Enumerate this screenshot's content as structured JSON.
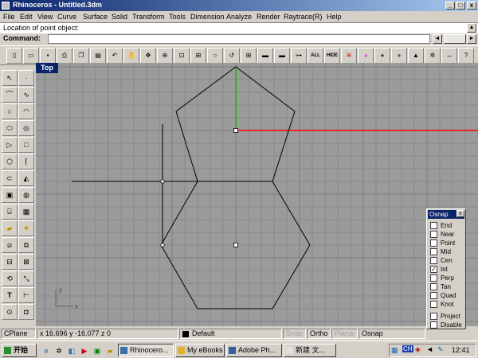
{
  "window": {
    "title": "Rhinoceros - Untitled.3dm",
    "buttons": [
      "_",
      "□",
      "x"
    ]
  },
  "menu": [
    "File",
    "Edit",
    "View",
    "Curve",
    "Surface",
    "Solid",
    "Transform",
    "Tools",
    "Dimension",
    "Analyze",
    "Render",
    "Raytrace(R)",
    "Help"
  ],
  "command": {
    "prompt": "Location of point object:",
    "label": "Command:",
    "value": ""
  },
  "toolbar": {
    "all_label": "ALL",
    "hide_label": "HIDE"
  },
  "viewport": {
    "label": "Top",
    "axis_x": "x",
    "axis_y": "y"
  },
  "osnap": {
    "title": "Osnap",
    "close": "x",
    "items": [
      {
        "label": "End",
        "checked": false
      },
      {
        "label": "Near",
        "checked": false
      },
      {
        "label": "Point",
        "checked": false
      },
      {
        "label": "Mid",
        "checked": false
      },
      {
        "label": "Cen",
        "checked": false
      },
      {
        "label": "Int",
        "checked": true
      },
      {
        "label": "Perp",
        "checked": false
      },
      {
        "label": "Tan",
        "checked": false
      },
      {
        "label": "Quad",
        "checked": false
      },
      {
        "label": "Knot",
        "checked": false
      },
      {
        "label": "Project",
        "checked": false
      },
      {
        "label": "Disable",
        "checked": false
      }
    ]
  },
  "status": {
    "cplane": "CPlane",
    "coords": "x 16.696  y -16.077  z 0",
    "layer": "Default",
    "snap": "Snap",
    "ortho": "Ortho",
    "planar": "Planar",
    "osnap": "Osnap"
  },
  "taskbar": {
    "start": "开始",
    "tasks": [
      "Rhinocero...",
      "My eBooks",
      "Adobe Ph...",
      "新建 文..."
    ],
    "clock": "12:41",
    "ime": "CH"
  },
  "colors": {
    "viewport_bg": "#9b9b9b",
    "grid_major": "#8a8a8a",
    "x_axis": "#ff0000",
    "y_axis": "#00c000",
    "title_bar": "#0a246a"
  }
}
